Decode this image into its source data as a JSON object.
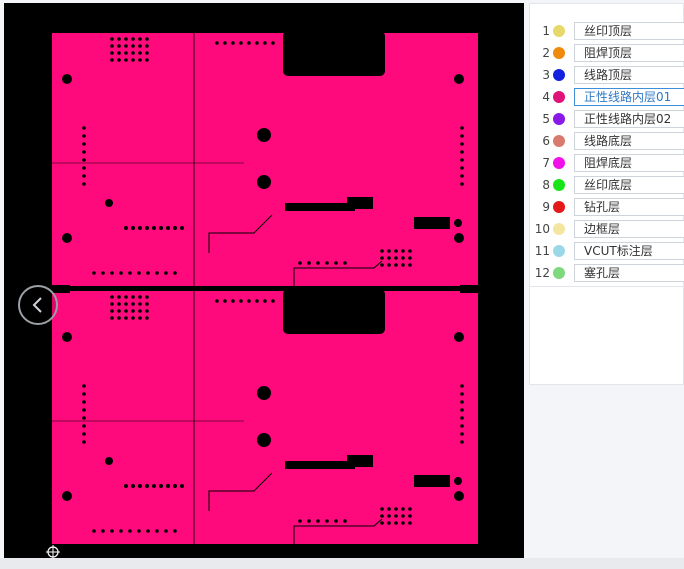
{
  "viewer": {
    "board_color": "#ff0a7c",
    "nav_prev_icon": "chevron-left-icon",
    "crosshair_icon": "crosshair-icon"
  },
  "layers": [
    {
      "num": "1",
      "name": "丝印顶层",
      "color": "#e8d86a",
      "active": false
    },
    {
      "num": "2",
      "name": "阻焊顶层",
      "color": "#f08a0c",
      "active": false
    },
    {
      "num": "3",
      "name": "线路顶层",
      "color": "#1420e0",
      "active": false
    },
    {
      "num": "4",
      "name": "正性线路内层01",
      "color": "#e0127a",
      "active": true
    },
    {
      "num": "5",
      "name": "正性线路内层02",
      "color": "#8a18e6",
      "active": false
    },
    {
      "num": "6",
      "name": "线路底层",
      "color": "#d97a6e",
      "active": false
    },
    {
      "num": "7",
      "name": "阻焊底层",
      "color": "#f012e8",
      "active": false
    },
    {
      "num": "8",
      "name": "丝印底层",
      "color": "#18e418",
      "active": false
    },
    {
      "num": "9",
      "name": "钻孔层",
      "color": "#e41818",
      "active": false
    },
    {
      "num": "10",
      "name": "边框层",
      "color": "#f2e6a0",
      "active": false
    },
    {
      "num": "11",
      "name": "VCUT标注层",
      "color": "#9ad8e8",
      "active": false
    },
    {
      "num": "12",
      "name": "塞孔层",
      "color": "#7ed87e",
      "active": false
    }
  ]
}
